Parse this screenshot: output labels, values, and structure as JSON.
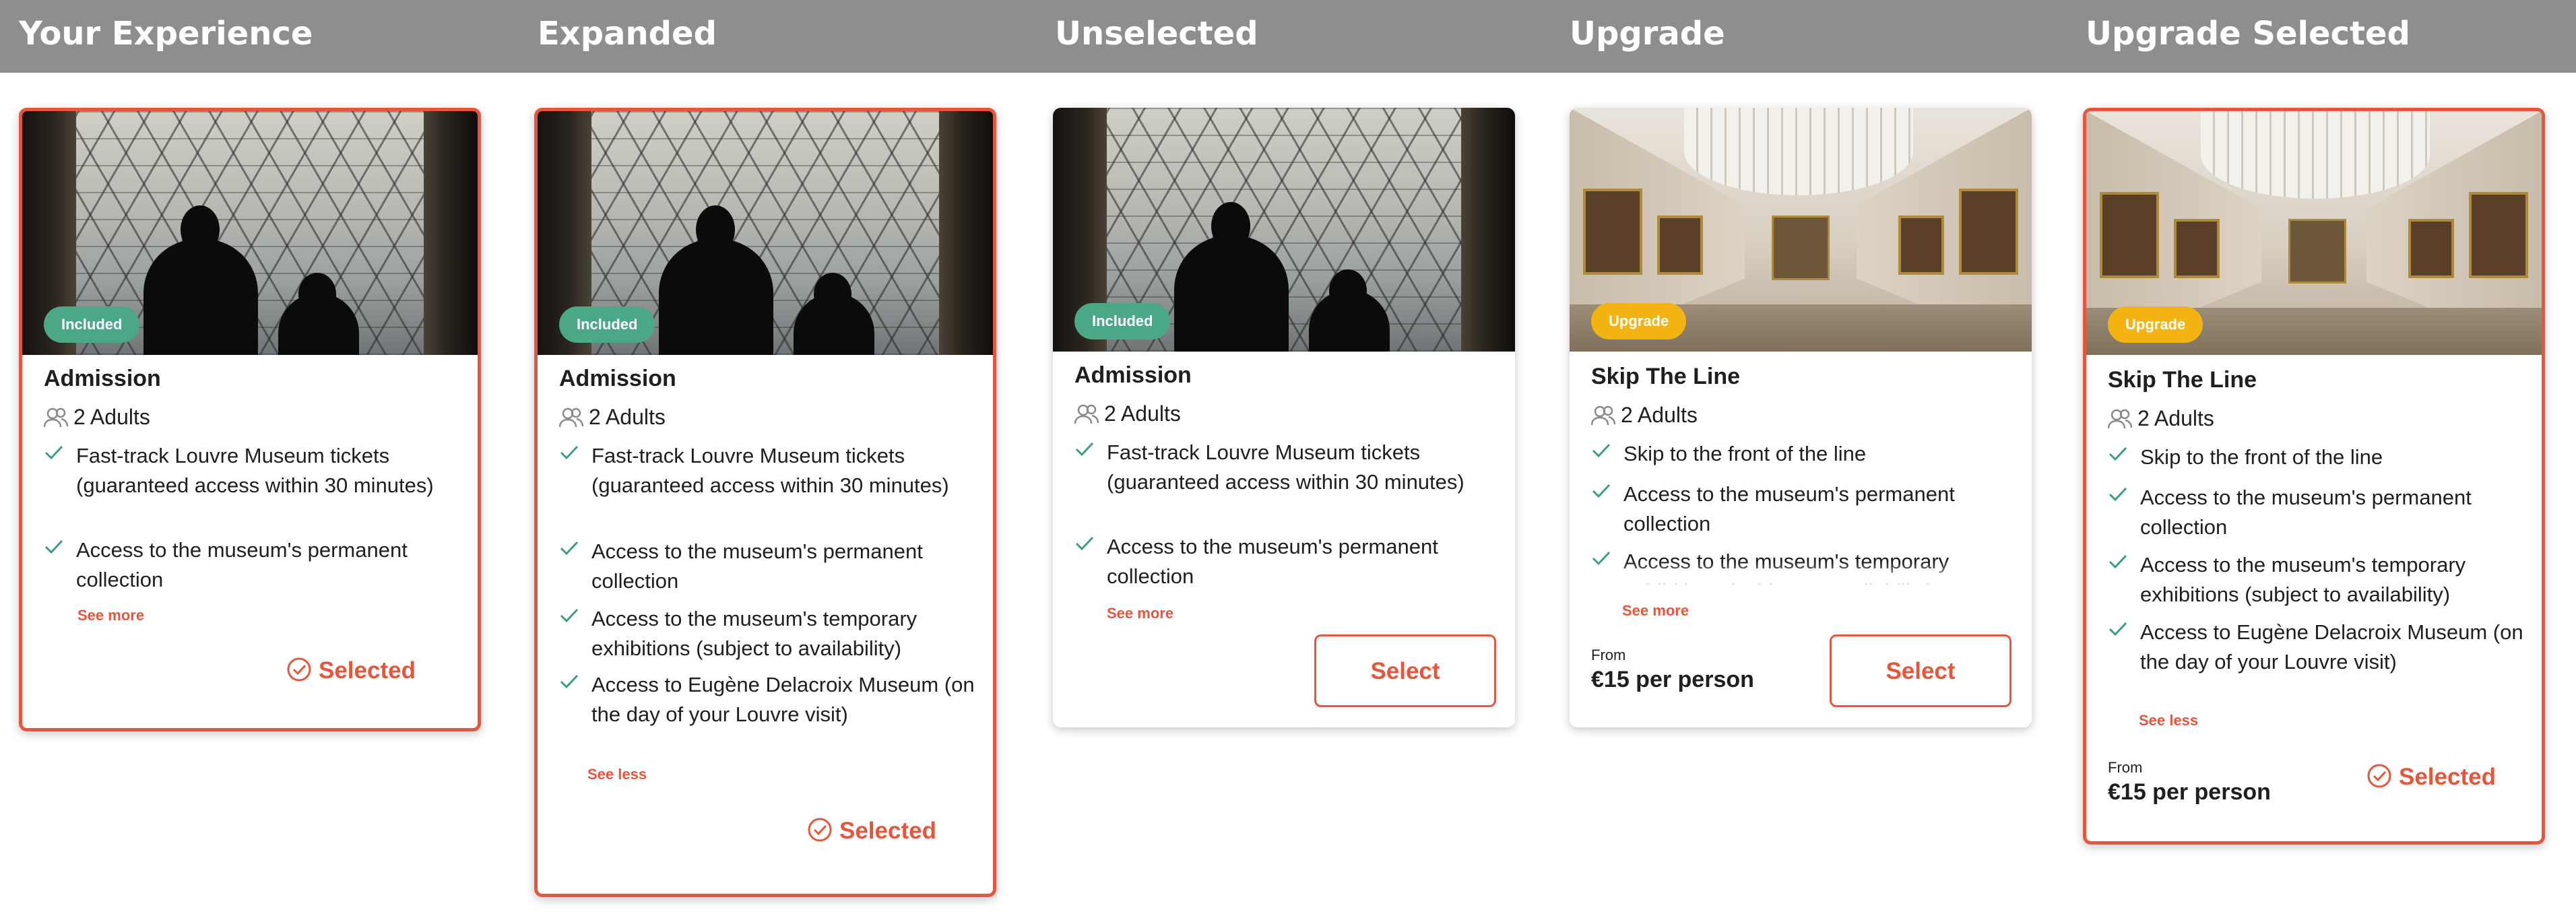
{
  "columns": [
    {
      "title": "Your Experience"
    },
    {
      "title": "Expanded"
    },
    {
      "title": "Unselected"
    },
    {
      "title": "Upgrade"
    },
    {
      "title": "Upgrade Selected"
    }
  ],
  "admission": {
    "badge": "Included",
    "title": "Admission",
    "guests": "2 Adults",
    "features": [
      "Fast-track Louvre Museum tickets (guaranteed access within 30 minutes)",
      "Access to the museum's permanent collection",
      "Access to the museum's temporary exhibitions (subject to availability)",
      "Access to Eugène Delacroix Museum (on the day of your Louvre visit)"
    ]
  },
  "upgrade": {
    "badge": "Upgrade",
    "title": "Skip The Line",
    "guests": "2 Adults",
    "features": [
      "Skip to the front of the line",
      "Access to the museum's permanent collection",
      "Access to the museum's temporary exhibitions (subject to availability)",
      "Access to Eugène Delacroix Museum (on the day of your Louvre visit)"
    ],
    "from_label": "From",
    "price": "€15 per person"
  },
  "actions": {
    "see_more": "See more",
    "see_less": "See less",
    "selected": "Selected",
    "select": "Select"
  },
  "colors": {
    "accent": "#e9553a",
    "included_badge": "#4aa886",
    "upgrade_badge": "#f2b313",
    "check": "#3aa07a",
    "header_bar": "#8e8e8e"
  },
  "icons": {
    "guests": "users-icon",
    "feature": "check-icon",
    "selected": "check-circle-icon"
  }
}
